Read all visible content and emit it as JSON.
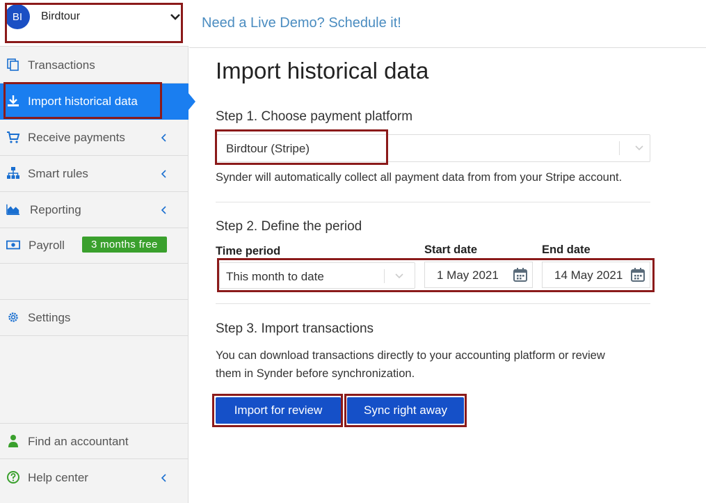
{
  "sidebar": {
    "company": {
      "initials": "BI",
      "name": "Birdtour"
    },
    "items": [
      {
        "label": "Transactions",
        "icon": "copy-icon"
      },
      {
        "label": "Import historical data",
        "icon": "download-icon"
      },
      {
        "label": "Receive payments",
        "icon": "cart-icon"
      },
      {
        "label": "Smart rules",
        "icon": "sitemap-icon"
      },
      {
        "label": "Reporting",
        "icon": "area-chart-icon"
      },
      {
        "label": "Payroll",
        "icon": "money-icon",
        "badge": "3 months free"
      },
      {
        "label": "Settings",
        "icon": "gear-icon"
      },
      {
        "label": "Find an accountant",
        "icon": "user-tie-icon"
      },
      {
        "label": "Help center",
        "icon": "question-circle-icon"
      }
    ]
  },
  "header": {
    "demo_link": "Need a Live Demo? Schedule it!"
  },
  "main": {
    "title": "Import historical data",
    "step1": {
      "heading": "Step 1. Choose payment platform",
      "platform": "Birdtour (Stripe)",
      "note": "Synder will automatically collect all payment data from from your Stripe account."
    },
    "step2": {
      "heading": "Step 2. Define the period",
      "time_period_label": "Time period",
      "time_period_value": "This month to date",
      "start_label": "Start date",
      "start_value": "1 May 2021",
      "end_label": "End date",
      "end_value": "14 May 2021"
    },
    "step3": {
      "heading": "Step 3. Import transactions",
      "note_line1": "You can download transactions directly to your accounting platform or review",
      "note_line2": "them in Synder before synchronization.",
      "import_button": "Import for review",
      "sync_button": "Sync right away"
    }
  },
  "colors": {
    "accent": "#1a7ef0",
    "button": "#1550c8",
    "highlight": "#8b1a1a",
    "badge": "#3aa02d",
    "link": "#4a8cc0"
  }
}
